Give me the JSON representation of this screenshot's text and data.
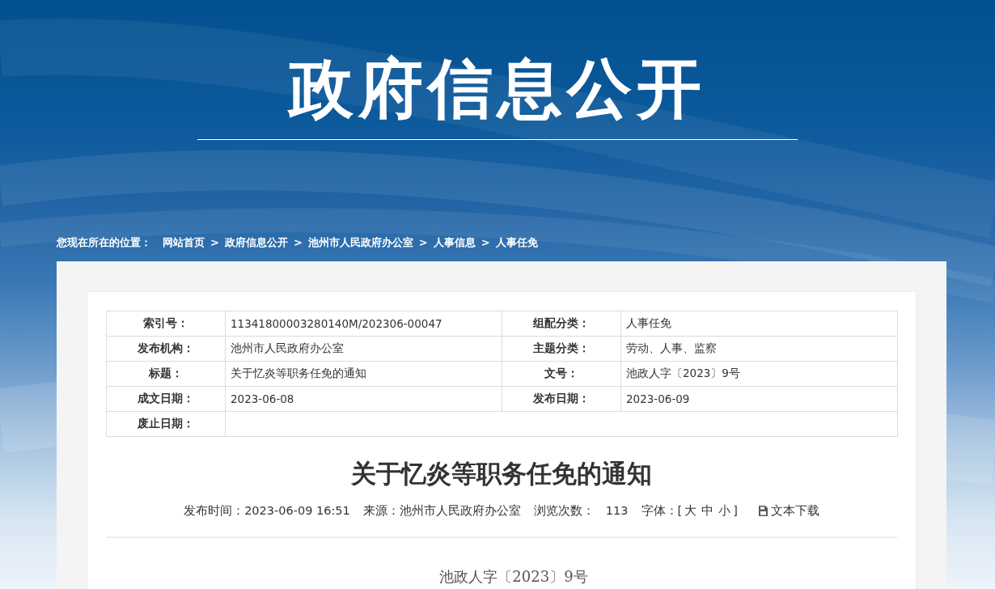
{
  "header": {
    "title": "政府信息公开"
  },
  "breadcrumb": {
    "label": "您现在所在的位置：",
    "items": [
      {
        "label": "网站首页"
      },
      {
        "separator": ">",
        "label": "政府信息公开"
      },
      {
        "separator": ">",
        "label": "池州市人民政府办公室"
      },
      {
        "separator": ">",
        "label": "人事信息"
      },
      {
        "separator": ">",
        "label": "人事任免"
      }
    ]
  },
  "info_table": {
    "rows": [
      [
        {
          "label": "索引号：",
          "value": "11341800003280140M/202306-00047"
        },
        {
          "label": "组配分类：",
          "value": "人事任免"
        }
      ],
      [
        {
          "label": "发布机构：",
          "value": "池州市人民政府办公室"
        },
        {
          "label": "主题分类：",
          "value": "劳动、人事、监察"
        }
      ],
      [
        {
          "label": "标题：",
          "value": "关于忆炎等职务任免的通知"
        },
        {
          "label": "文号：",
          "value": "池政人字〔2023〕9号"
        }
      ],
      [
        {
          "label": "成文日期：",
          "value": "2023-06-08"
        },
        {
          "label": "发布日期：",
          "value": "2023-06-09"
        }
      ],
      [
        {
          "label": "废止日期："
        }
      ]
    ]
  },
  "article": {
    "title": "关于忆炎等职务任免的通知",
    "meta": [
      {
        "kind": "field",
        "label": "发布时间：",
        "value": "2023-06-09 16:51"
      },
      {
        "kind": "field",
        "label": "来源：",
        "value": "池州市人民政府办公室"
      },
      {
        "kind": "counter",
        "label": "浏览次数：",
        "value": "113"
      },
      {
        "kind": "font_size",
        "label": "字体：",
        "open": "[",
        "options": [
          "大",
          "中",
          "小"
        ],
        "close": "]"
      },
      {
        "kind": "download",
        "label": "文本下载"
      }
    ],
    "doc_number": "池政人字〔2023〕9号"
  }
}
